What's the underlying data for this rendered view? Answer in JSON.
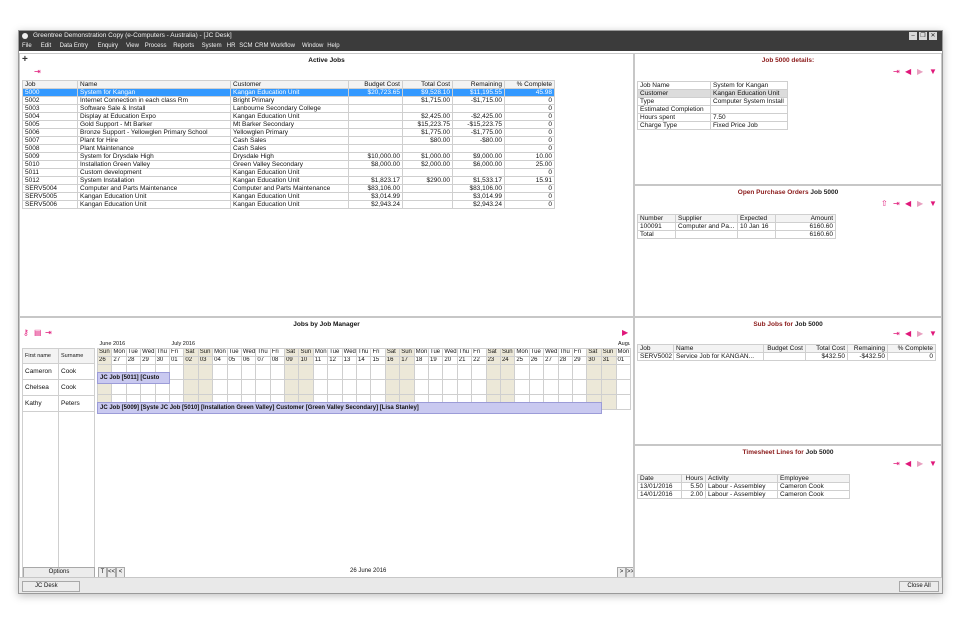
{
  "window": {
    "title": "Greentree Demonstration Copy (e-Computers - Australia) - [JC Desk]",
    "controls": [
      "–",
      "❐",
      "✕"
    ]
  },
  "menu": [
    "File",
    "Edit",
    "Data Entry",
    "Enquiry",
    "View",
    "Process",
    "Reports",
    "System",
    "HR",
    "SCM",
    "CRM",
    "Workflow",
    "Window",
    "Help"
  ],
  "active_jobs": {
    "title": "Active Jobs",
    "columns": [
      "Job",
      "Name",
      "Customer",
      "Budget Cost",
      "Total Cost",
      "Remaining",
      "% Complete"
    ],
    "rows": [
      [
        "5000",
        "System for Kangan",
        "Kangan Education Unit",
        "$20,723.65",
        "$9,528.10",
        "$11,195.55",
        "45.98"
      ],
      [
        "5002",
        "Internet Connection in each class Rm",
        "Bright Primary",
        "",
        "$1,715.00",
        "-$1,715.00",
        "0"
      ],
      [
        "5003",
        "Software Sale & Install",
        "Lanbourne Secondary College",
        "",
        "",
        "",
        "0"
      ],
      [
        "5004",
        "Display at Education Expo",
        "Kangan Education Unit",
        "",
        "$2,425.00",
        "-$2,425.00",
        "0"
      ],
      [
        "5005",
        "Gold Support - Mt Barker",
        "Mt Barker Secondary",
        "",
        "$15,223.75",
        "-$15,223.75",
        "0"
      ],
      [
        "5006",
        "Bronze Support - Yellowglen Primary School",
        "Yellowglen Primary",
        "",
        "$1,775.00",
        "-$1,775.00",
        "0"
      ],
      [
        "5007",
        "Plant for Hire",
        "Cash Sales",
        "",
        "$80.00",
        "-$80.00",
        "0"
      ],
      [
        "5008",
        "Plant Maintenance",
        "Cash Sales",
        "",
        "",
        "",
        "0"
      ],
      [
        "5009",
        "System for Drysdale High",
        "Drysdale High",
        "$10,000.00",
        "$1,000.00",
        "$9,000.00",
        "10.00"
      ],
      [
        "5010",
        "Installation Green Valley",
        "Green Valley Secondary",
        "$8,000.00",
        "$2,000.00",
        "$6,000.00",
        "25.00"
      ],
      [
        "5011",
        "Custom development",
        "Kangan Education Unit",
        "",
        "",
        "",
        "0"
      ],
      [
        "5012",
        "System Installation",
        "Kangan Education Unit",
        "$1,823.17",
        "$290.00",
        "$1,533.17",
        "15.91"
      ],
      [
        "SERV5004",
        "Computer and Parts Maintenance",
        "Computer and Parts Maintenance",
        "$83,106.00",
        "",
        "$83,106.00",
        "0"
      ],
      [
        "SERV5005",
        "Kangan Education Unit",
        "Kangan Education Unit",
        "$3,014.99",
        "",
        "$3,014.99",
        "0"
      ],
      [
        "SERV5006",
        "Kangan Education Unit",
        "Kangan Education Unit",
        "$2,943.24",
        "",
        "$2,943.24",
        "0"
      ]
    ]
  },
  "job_details": {
    "title": "Job 5000 details:",
    "rows": [
      [
        "Job Name",
        "System for Kangan"
      ],
      [
        "Customer",
        "Kangan Education Unit"
      ],
      [
        "Type",
        "Computer System Install"
      ],
      [
        "Estimated Completion",
        ""
      ],
      [
        "Hours spent",
        "7.50"
      ],
      [
        "Charge Type",
        "Fixed Price Job"
      ]
    ]
  },
  "purchase_orders": {
    "title": "Open Purchase Orders",
    "title_job": "Job 5000",
    "columns": [
      "Number",
      "Supplier",
      "Expected",
      "Amount"
    ],
    "rows": [
      [
        "100091",
        "Computer and Pa...",
        "10 Jan 16",
        "6160.60"
      ]
    ],
    "total_label": "Total",
    "total": "6160.60"
  },
  "gantt": {
    "title": "Jobs by Job Manager",
    "col_first": "First name",
    "col_last": "Surname",
    "managers": [
      [
        "Cameron",
        "Cook"
      ],
      [
        "Chelsea",
        "Cook"
      ],
      [
        "Kathy",
        "Peters"
      ]
    ],
    "months": [
      "June 2016",
      "July 2016",
      "August"
    ],
    "days": [
      "Sun",
      "Mon",
      "Tue",
      "Wed",
      "Thu",
      "Fri",
      "Sat",
      "Sun",
      "Mon",
      "Tue",
      "Wed",
      "Thu",
      "Fri",
      "Sat",
      "Sun",
      "Mon",
      "Tue",
      "Wed",
      "Thu",
      "Fri",
      "Sat",
      "Sun",
      "Mon",
      "Tue",
      "Wed",
      "Thu",
      "Fri",
      "Sat",
      "Sun",
      "Mon",
      "Tue",
      "Wed",
      "Thu",
      "Fri",
      "Sat",
      "Sun",
      "Mon"
    ],
    "dates": [
      "26",
      "27",
      "28",
      "29",
      "30",
      "01",
      "02",
      "03",
      "04",
      "05",
      "06",
      "07",
      "08",
      "09",
      "10",
      "11",
      "12",
      "13",
      "14",
      "15",
      "16",
      "17",
      "18",
      "19",
      "20",
      "21",
      "22",
      "23",
      "24",
      "25",
      "26",
      "27",
      "28",
      "29",
      "30",
      "31",
      "01"
    ],
    "bar1": "JC Job [5011] [Custo",
    "bar2": "JC Job [5009] [Syste JC Job [5010] [Installation Green Valley] Customer [Green Valley Secondary] [Lisa Stanley]",
    "options_label": "Options",
    "date_label": "26 June 2016",
    "nav_left": [
      "T",
      "<<",
      "<"
    ],
    "nav_right": [
      ">",
      ">>"
    ]
  },
  "sub_jobs": {
    "title": "Sub Jobs for",
    "title_job": "Job 5000",
    "columns": [
      "Job",
      "Name",
      "Budget Cost",
      "Total Cost",
      "Remaining",
      "% Complete"
    ],
    "rows": [
      [
        "SERV5002",
        "Service Job for KANGAN...",
        "",
        "$432.50",
        "-$432.50",
        "0"
      ]
    ]
  },
  "timesheet": {
    "title": "Timesheet Lines for",
    "title_job": "Job 5000",
    "columns": [
      "Date",
      "Hours",
      "Activity",
      "Employee"
    ],
    "rows": [
      [
        "13/01/2016",
        "5.50",
        "Labour - Assembley",
        "Cameron Cook"
      ],
      [
        "14/01/2016",
        "2.00",
        "Labour - Assembley",
        "Cameron Cook"
      ]
    ]
  },
  "status": {
    "tab_label": "JC Desk",
    "close_all": "Close All"
  },
  "colors": {
    "accent": "#e0187a",
    "titlebar": "#3b3b3b",
    "selection": "#3399ff",
    "weekend": "#ece8d8",
    "bar": "#c9c9f0"
  }
}
